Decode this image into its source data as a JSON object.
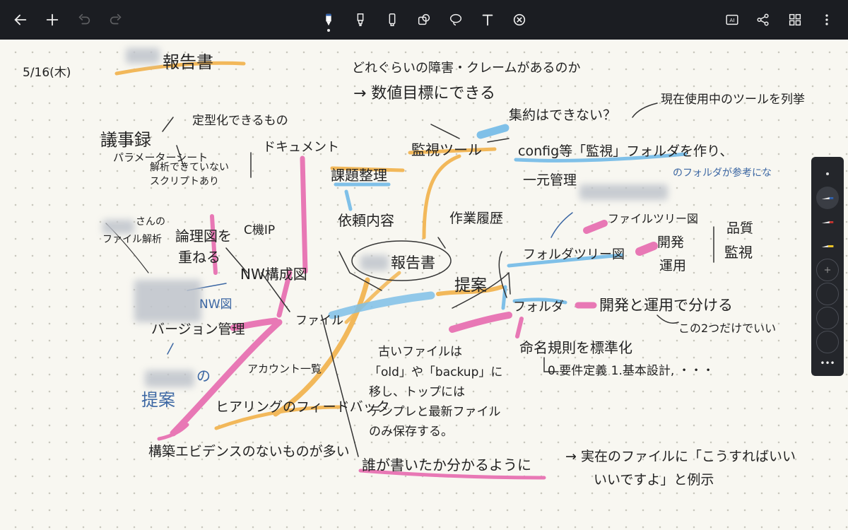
{
  "toolbar": {
    "left_icons": [
      "back-arrow-icon",
      "add-icon",
      "undo-icon",
      "redo-icon"
    ],
    "tools": [
      "fountain-pen-icon",
      "marker-icon",
      "highlighter-icon",
      "shape-icon",
      "lasso-icon",
      "text-icon",
      "eraser-icon"
    ],
    "right_icons": [
      "ai-icon",
      "share-icon",
      "grid-view-icon",
      "more-vert-icon"
    ],
    "ai_label": "AI"
  },
  "palette": {
    "colors": {
      "blue": "#2c5fae",
      "red": "#c8322d",
      "yellow": "#f0c419"
    },
    "more_label": "•••"
  },
  "notes": {
    "date": "5/16(木)",
    "title": "報告書",
    "top1": "どれぐらいの障害・クレームがあるのか",
    "top2": "→ 数値目標にできる",
    "shuyaku": "集約はできない？",
    "genzai": "現在使用中のツールを列挙",
    "kanshi_tool": "監視ツール",
    "config1": "config等「監視」フォルダを作り、",
    "config2": "一元管理",
    "ref_folder": "のフォルダが参考にな",
    "kadai": "課題整理",
    "irai": "依頼内容",
    "sagyo": "作業履歴",
    "center": "報告書",
    "teian": "提案",
    "gijiroku": "議事録",
    "parameter": "パラメーターシート",
    "teikei": "定型化できるもの",
    "document": "ドキュメント",
    "kaiseki1": "解析できていない",
    "kaiseki2": "スクリプトあり",
    "san_no": "さんの",
    "file_kaiseki": "ファイル解析",
    "ronri1": "論理図を",
    "ronri2": "重ねる",
    "ip": "C機IP",
    "nw": "NW構成図",
    "nw_zu": "NW図",
    "version": "バージョン管理",
    "file": "ファイル",
    "account": "アカウント一覧",
    "no": "の",
    "teian_blue": "提案",
    "hearing": "ヒアリングのフィードバック",
    "kouchiku": "構築エビデンスのないものが多い",
    "old1": "古いファイルは",
    "old2": "「old」や「backup」に",
    "old3": "移し、トップには",
    "old4": "テンプレと最新ファイル",
    "old5": "のみ保存する。",
    "dare": "誰が書いたか分かるように",
    "jitsuzai1": "→ 実在のファイルに「こうすればいい",
    "jitsuzai2": "いいですよ」と例示",
    "file_tree": "ファイルツリー図",
    "folder_tree": "フォルダツリー図",
    "kaihatsu": "開発",
    "unyou": "運用",
    "hinshitsu": "品質",
    "kanshi": "監視",
    "folder": "フォルダ",
    "kaihatsu_unyou": "開発と運用で分ける",
    "kono2": "この2つだけでいい",
    "meimei": "命名規則を標準化",
    "youken": "0.要件定義 1.基本設計, ・・・"
  }
}
